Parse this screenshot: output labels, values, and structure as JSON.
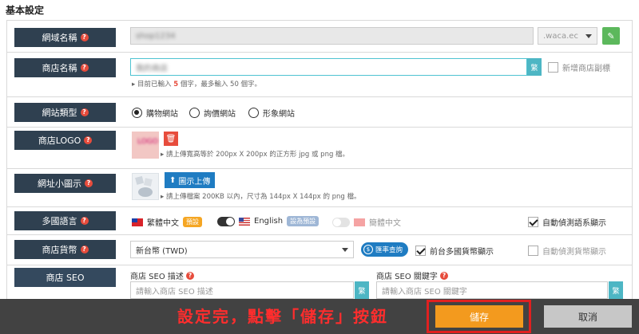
{
  "section_title": "基本設定",
  "rows": {
    "domain": {
      "label": "網域名稱",
      "value": "shop1234",
      "suffix": ".waca.ec"
    },
    "store_name": {
      "label": "商店名稱",
      "value": "我的商店",
      "addon": "繁",
      "subtitle_checkbox": "新增商店副標",
      "hint_prefix": "目前已輸入",
      "hint_count": "5",
      "hint_suffix": "個字，最多輸入 50 個字。"
    },
    "site_type": {
      "label": "網站類型",
      "options": [
        "購物網站",
        "詢價網站",
        "形象網站"
      ]
    },
    "logo": {
      "label": "商店LOGO",
      "thumb_text": "LOGO",
      "hint": "請上傳寬高等於 200px X 200px 的正方形 jpg 或 png 檔。"
    },
    "favicon": {
      "label": "網址小圖示",
      "upload_label": "圖示上傳",
      "hint": "請上傳檔案 200KB 以內，尺寸為 144px X 144px 的 png 檔。"
    },
    "language": {
      "label": "多國語言",
      "lang1": "繁體中文",
      "lang1_badge": "預設",
      "lang2": "English",
      "lang2_badge": "設為預設",
      "lang3": "簡體中文",
      "auto_detect": "自動偵測語系顯示"
    },
    "currency": {
      "label": "商店貨幣",
      "selected": "新台幣 (TWD)",
      "rate_button": "匯率查詢",
      "multi_currency": "前台多國貨幣顯示",
      "auto_detect": "自動偵測貨幣顯示"
    },
    "seo": {
      "label": "商店 SEO",
      "desc_label": "商店 SEO 描述",
      "desc_placeholder": "請輸入商店 SEO 描述",
      "keyword_label": "商店 SEO 關鍵字",
      "keyword_placeholder": "請輸入商店 SEO 關鍵字",
      "addon": "繁"
    }
  },
  "bottom": {
    "callout": "設定完，點擊「儲存」按鈕",
    "save": "儲存",
    "cancel": "取消"
  },
  "icons": {
    "qmark": "?",
    "edit": "✎",
    "trash": "🗑",
    "upload": "⬆",
    "coin": "$",
    "caret_right": "▸"
  }
}
